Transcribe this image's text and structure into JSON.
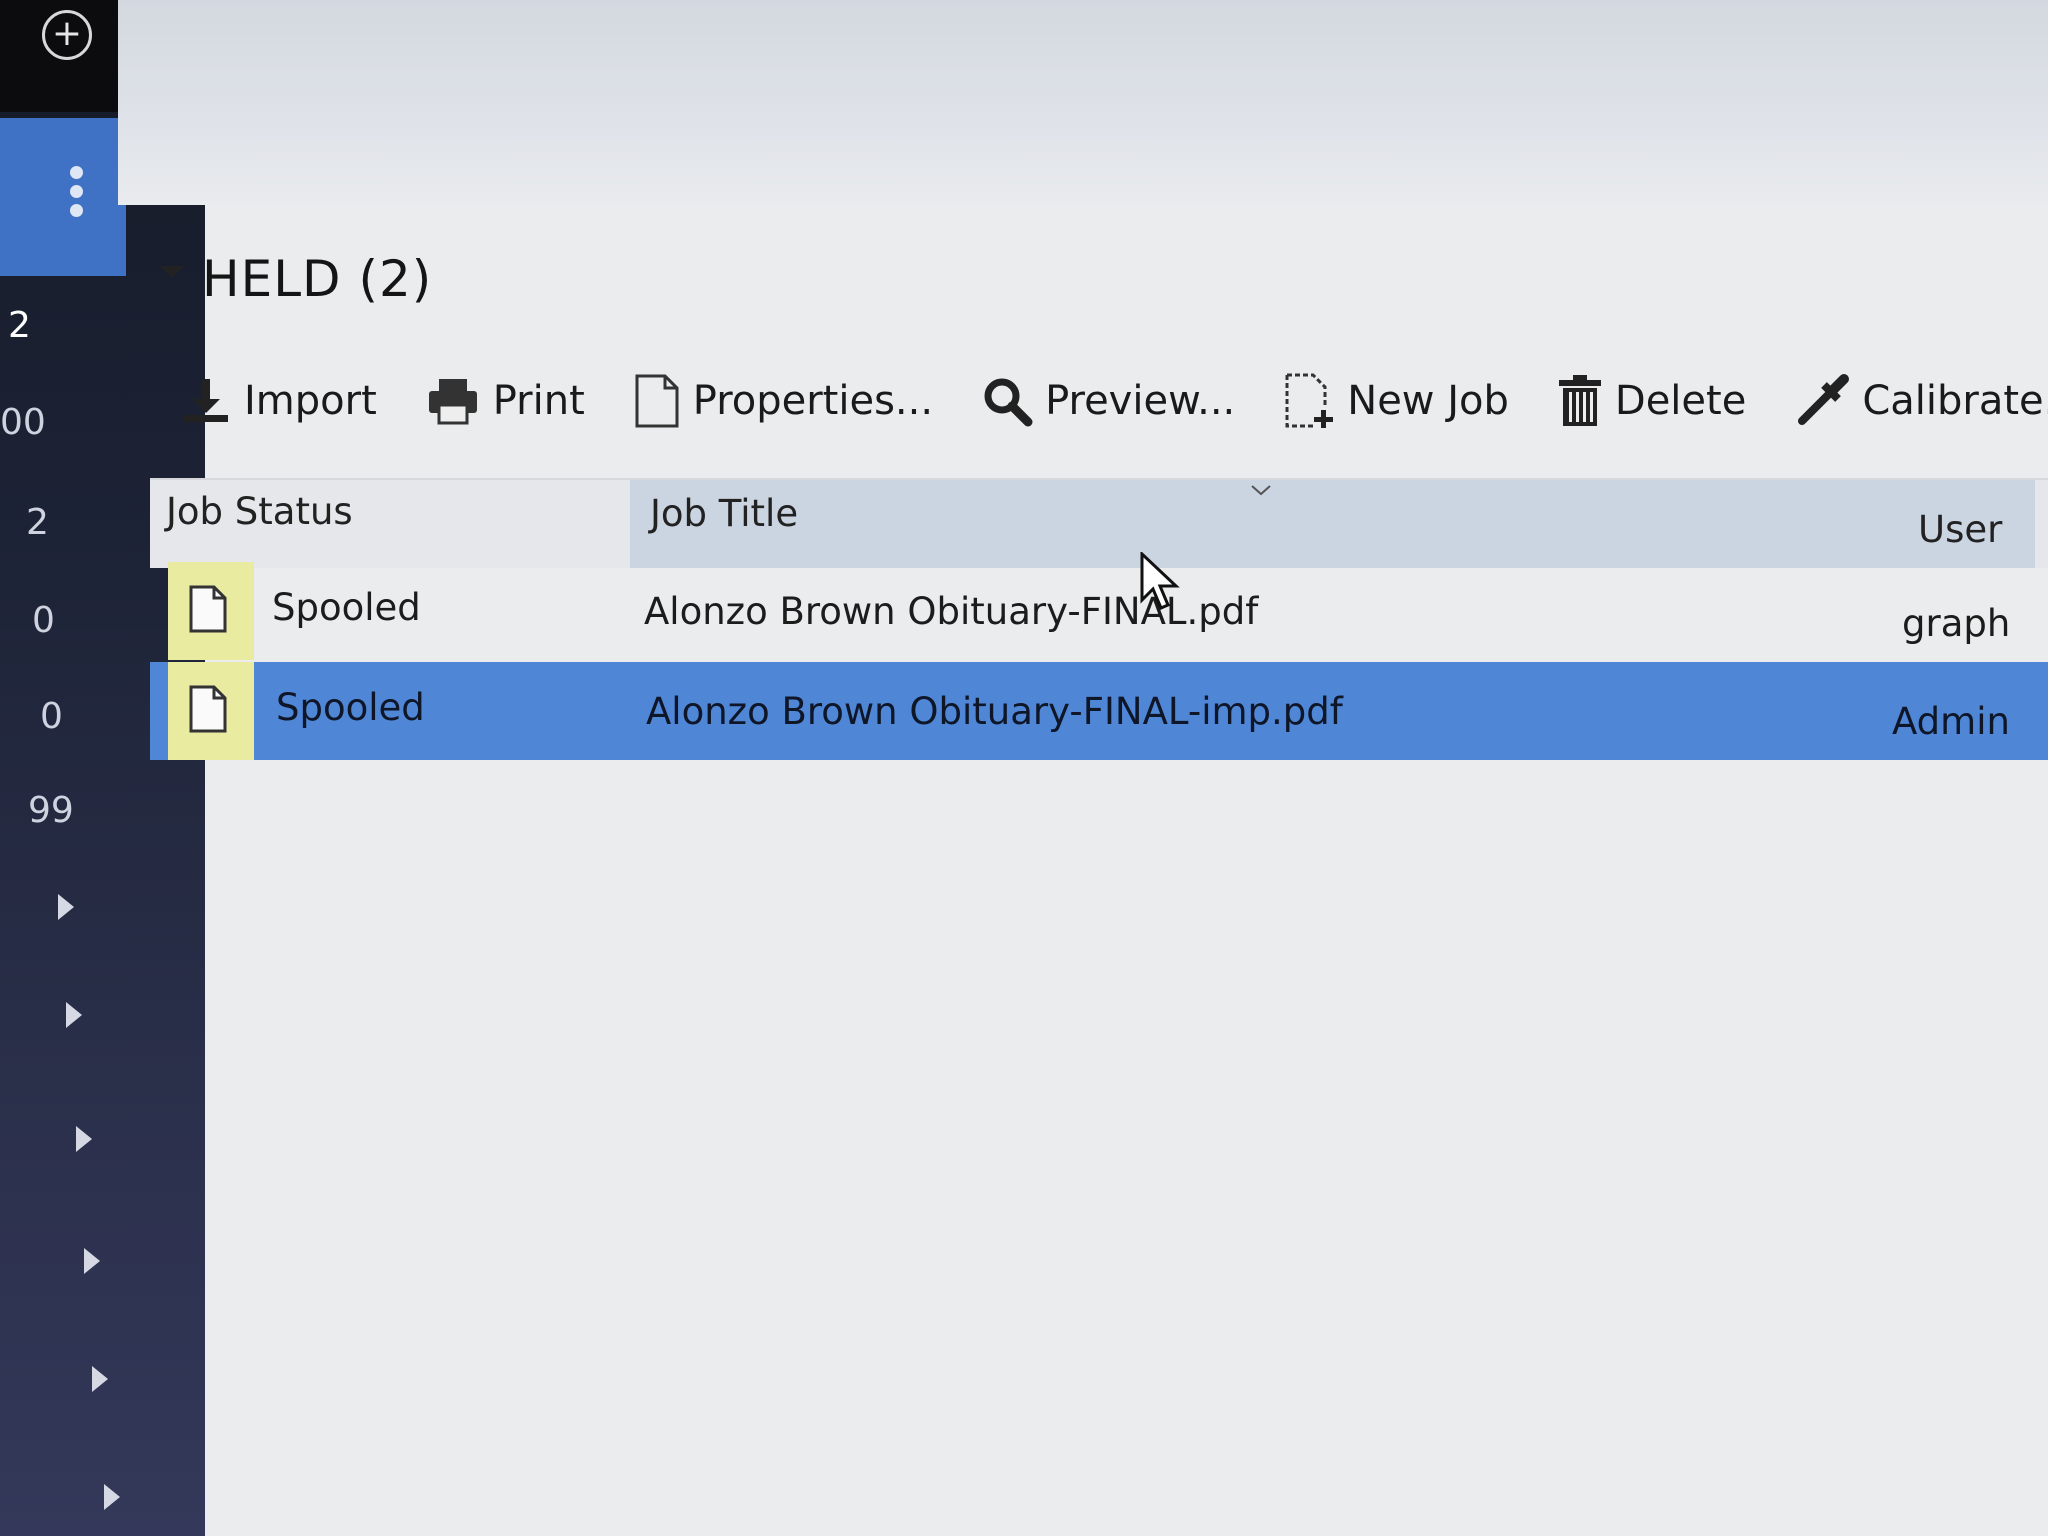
{
  "sidebar": {
    "counts": [
      "2",
      "00",
      "2",
      "0",
      "0",
      "99"
    ],
    "icons": {
      "add": "plus-circle-icon",
      "more": "more-vertical-icon",
      "expand": "triangle-right-icon"
    }
  },
  "held": {
    "title": "HELD (2)"
  },
  "toolbar": {
    "import_label": "Import",
    "print_label": "Print",
    "properties_label": "Properties...",
    "preview_label": "Preview...",
    "new_job_label": "New Job",
    "delete_label": "Delete",
    "calibrate_label": "Calibrate..."
  },
  "table": {
    "columns": {
      "status": "Job Status",
      "title": "Job Title",
      "user": "User"
    },
    "rows": [
      {
        "status": "Spooled",
        "title": "Alonzo Brown Obituary-FINAL.pdf",
        "user": "graph"
      },
      {
        "status": "Spooled",
        "title": "Alonzo Brown Obituary-FINAL-imp.pdf",
        "user": "Admin",
        "selected": true
      }
    ]
  },
  "colors": {
    "selection": "#4f86d6",
    "sidebar_selected": "#3f72c4",
    "status_icon_bg": "#e9eba0"
  }
}
